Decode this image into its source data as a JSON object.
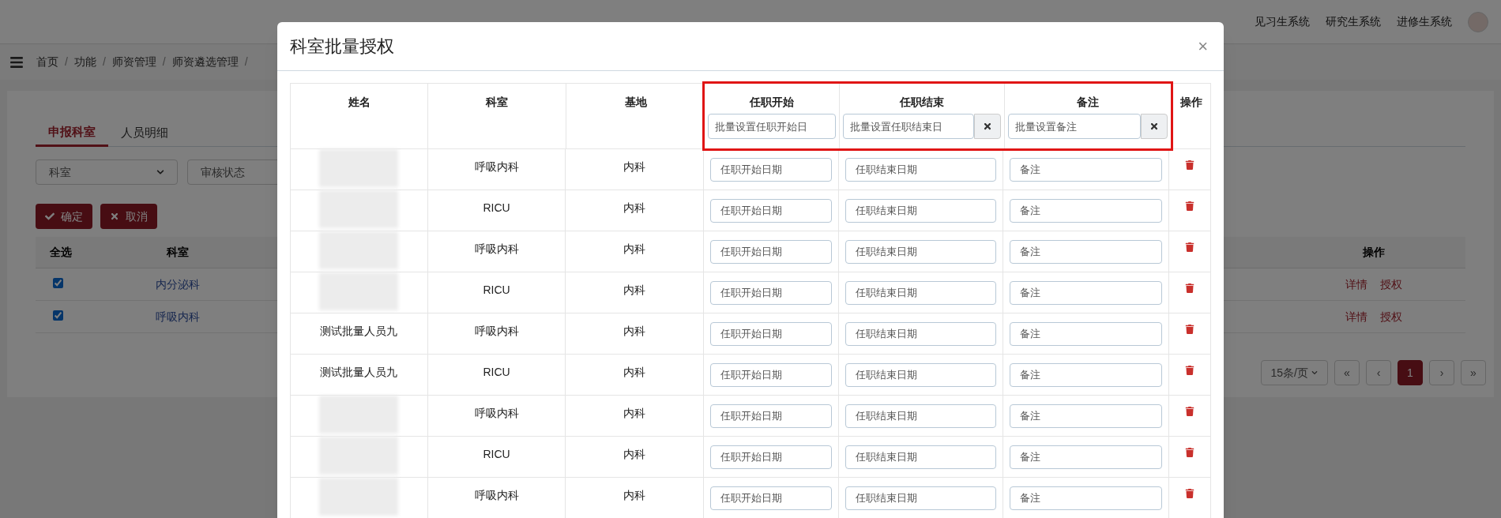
{
  "topbar": {
    "nav": [
      {
        "label": "见习生系统"
      },
      {
        "label": "研究生系统"
      },
      {
        "label": "进修生系统"
      }
    ]
  },
  "breadcrumb": [
    {
      "label": "首页",
      "separator": "/"
    },
    {
      "label": "功能",
      "separator": "/"
    },
    {
      "label": "师资管理",
      "separator": "/"
    },
    {
      "label": "师资遴选管理",
      "separator": "/"
    }
  ],
  "tabs": [
    {
      "label": "申报科室",
      "selected": true
    },
    {
      "label": "人员明细",
      "selected": false
    }
  ],
  "filters": [
    {
      "placeholder": "科室",
      "kind": "select"
    },
    {
      "placeholder": "审核状态",
      "kind": "field"
    }
  ],
  "actions": [
    {
      "label": "确定",
      "kind": "confirm"
    },
    {
      "label": "取消",
      "kind": "cancel"
    }
  ],
  "list": {
    "columns": [
      "全选",
      "科室",
      "操作"
    ],
    "rows": [
      {
        "checked": true,
        "department": "内分泌科",
        "links": [
          "详情",
          "授权"
        ]
      },
      {
        "checked": true,
        "department": "呼吸内科",
        "links": [
          "详情",
          "授权"
        ]
      }
    ]
  },
  "pagination": {
    "page_size": "15条/页",
    "pages": [
      {
        "label": "«",
        "selected": false
      },
      {
        "label": "‹",
        "selected": false
      },
      {
        "label": "1",
        "selected": true
      },
      {
        "label": "›",
        "selected": false
      },
      {
        "label": "»",
        "selected": false
      }
    ]
  },
  "modal": {
    "title": "科室批量授权",
    "close": "×",
    "table": {
      "columns": [
        {
          "label": "姓名",
          "highlighted": false
        },
        {
          "label": "科室",
          "highlighted": false
        },
        {
          "label": "基地",
          "highlighted": false
        },
        {
          "label": "任职开始",
          "highlighted": true,
          "batch": {
            "placeholder": "批量设置任职开始日",
            "clear": false
          }
        },
        {
          "label": "任职结束",
          "highlighted": true,
          "batch": {
            "placeholder": "批量设置任职结束日",
            "clear": true
          }
        },
        {
          "label": "备注",
          "highlighted": true,
          "batch": {
            "placeholder": "批量设置备注",
            "clear": true
          }
        },
        {
          "label": "操作",
          "highlighted": false
        }
      ],
      "rows": [
        {
          "kind": "blurred",
          "department": "呼吸内科",
          "base": "内科",
          "start_placeholder": "任职开始日期",
          "end_placeholder": "任职结束日期",
          "note_placeholder": "备注"
        },
        {
          "kind": "blurred",
          "department": "RICU",
          "base": "内科",
          "start_placeholder": "任职开始日期",
          "end_placeholder": "任职结束日期",
          "note_placeholder": "备注"
        },
        {
          "kind": "blurred",
          "department": "呼吸内科",
          "base": "内科",
          "start_placeholder": "任职开始日期",
          "end_placeholder": "任职结束日期",
          "note_placeholder": "备注"
        },
        {
          "kind": "blurred",
          "department": "RICU",
          "base": "内科",
          "start_placeholder": "任职开始日期",
          "end_placeholder": "任职结束日期",
          "note_placeholder": "备注"
        },
        {
          "kind": "named",
          "name": "测试批量人员九",
          "department": "呼吸内科",
          "base": "内科",
          "start_placeholder": "任职开始日期",
          "end_placeholder": "任职结束日期",
          "note_placeholder": "备注"
        },
        {
          "kind": "named",
          "name": "测试批量人员九",
          "department": "RICU",
          "base": "内科",
          "start_placeholder": "任职开始日期",
          "end_placeholder": "任职结束日期",
          "note_placeholder": "备注"
        },
        {
          "kind": "blurred",
          "department": "呼吸内科",
          "base": "内科",
          "start_placeholder": "任职开始日期",
          "end_placeholder": "任职结束日期",
          "note_placeholder": "备注"
        },
        {
          "kind": "blurred",
          "department": "RICU",
          "base": "内科",
          "start_placeholder": "任职开始日期",
          "end_placeholder": "任职结束日期",
          "note_placeholder": "备注"
        },
        {
          "kind": "blurred",
          "department": "呼吸内科",
          "base": "内科",
          "start_placeholder": "任职开始日期",
          "end_placeholder": "任职结束日期",
          "note_placeholder": "备注"
        }
      ]
    }
  }
}
